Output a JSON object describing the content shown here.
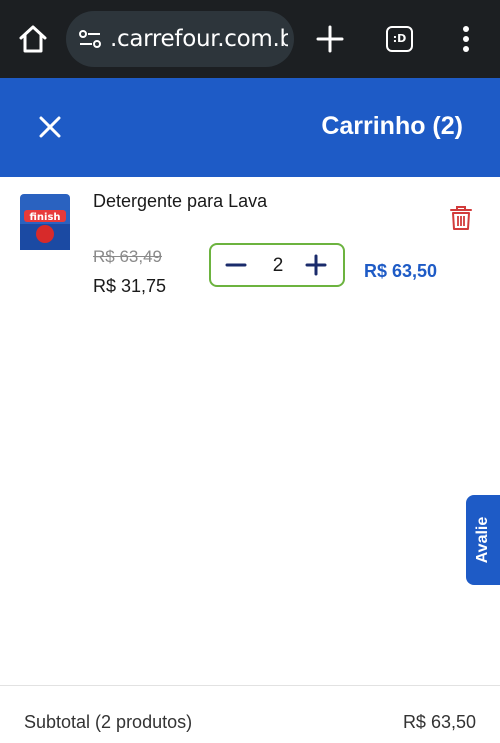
{
  "browser": {
    "url": ".carrefour.com.br",
    "tabs_label": ":D",
    "icons": [
      "home-icon",
      "site-settings-icon",
      "new-tab-plus-icon",
      "overflow-menu-icon"
    ]
  },
  "cart": {
    "title": "Carrinho (2)",
    "close_icon": "close-icon"
  },
  "product": {
    "name": "Detergente para Lava",
    "old_price": "R$ 63,49",
    "unit_price": "R$ 31,75",
    "quantity": "2",
    "line_total": "R$ 63,50",
    "image_label": "finish",
    "remove_icon": "trash-icon"
  },
  "feedback": {
    "label": "Avalie"
  },
  "footer": {
    "subtotal_label": "Subtotal (2 produtos)",
    "subtotal_value": "R$ 63,50"
  },
  "colors": {
    "brand_blue": "#1e5bc6",
    "browser_bg": "#1c1f22",
    "qty_border": "#6cb33f",
    "trash_red": "#d23b3b"
  }
}
